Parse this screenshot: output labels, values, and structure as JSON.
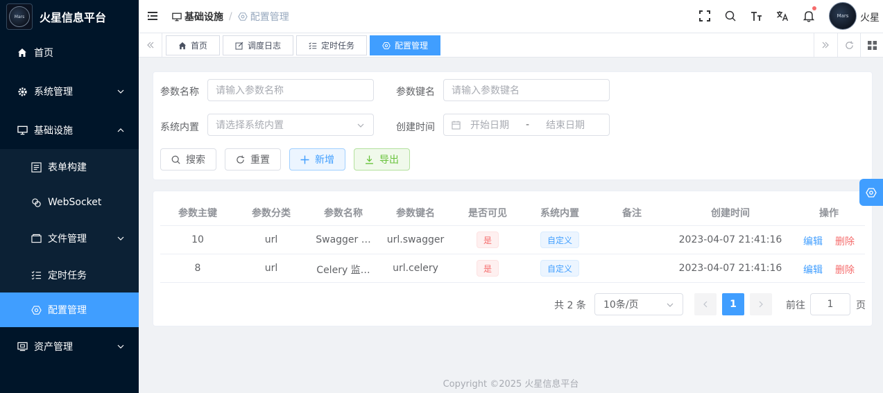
{
  "app": {
    "title": "火星信息平台",
    "logo_text": "MarsMgn",
    "user_name": "火星",
    "footer": "Copyright ©2025 火星信息平台"
  },
  "sidebar": {
    "items": [
      {
        "label": "首页",
        "icon": "home-icon"
      },
      {
        "label": "系统管理",
        "icon": "gear-icon",
        "expandable": true
      },
      {
        "label": "基础设施",
        "icon": "monitor-icon",
        "expandable": true,
        "expanded": true
      },
      {
        "label": "表单构建",
        "icon": "form-icon",
        "sub": true
      },
      {
        "label": "WebSocket",
        "icon": "link-icon",
        "sub": true
      },
      {
        "label": "文件管理",
        "icon": "folder-icon",
        "sub": true,
        "expandable": true
      },
      {
        "label": "定时任务",
        "icon": "task-list-icon",
        "sub": true
      },
      {
        "label": "配置管理",
        "icon": "config-icon",
        "sub": true,
        "active": true
      },
      {
        "label": "资产管理",
        "icon": "asset-icon",
        "expandable": true
      }
    ]
  },
  "header": {
    "breadcrumb": [
      "基础设施",
      "配置管理"
    ]
  },
  "tags": [
    {
      "label": "首页",
      "icon": "home-icon"
    },
    {
      "label": "调度日志",
      "icon": "edit-icon"
    },
    {
      "label": "定时任务",
      "icon": "task-list-icon"
    },
    {
      "label": "配置管理",
      "icon": "config-icon",
      "active": true
    }
  ],
  "search": {
    "param_name_label": "参数名称",
    "param_name_placeholder": "请输入参数名称",
    "param_key_label": "参数键名",
    "param_key_placeholder": "请输入参数键名",
    "builtin_label": "系统内置",
    "builtin_placeholder": "请选择系统内置",
    "created_label": "创建时间",
    "start_placeholder": "开始日期",
    "range_sep": "-",
    "end_placeholder": "结束日期",
    "btn_search": "搜索",
    "btn_reset": "重置",
    "btn_add": "新增",
    "btn_export": "导出"
  },
  "table": {
    "columns": [
      "参数主键",
      "参数分类",
      "参数名称",
      "参数键名",
      "是否可见",
      "系统内置",
      "备注",
      "创建时间",
      "操作"
    ],
    "rows": [
      {
        "id": "10",
        "category": "url",
        "name": "Swagger …",
        "key": "url.swagger",
        "visible": "是",
        "builtin": "自定义",
        "remark": "",
        "created": "2023-04-07 21:41:16"
      },
      {
        "id": "8",
        "category": "url",
        "name": "Celery 监…",
        "key": "url.celery",
        "visible": "是",
        "builtin": "自定义",
        "remark": "",
        "created": "2023-04-07 21:41:16"
      }
    ],
    "action_edit": "编辑",
    "action_delete": "删除"
  },
  "pagination": {
    "total": "共 2 条",
    "page_size": "10条/页",
    "current": "1",
    "goto_label": "前往",
    "goto_value": "1",
    "page_suffix": "页"
  },
  "colors": {
    "sidebar_bg": "#001529",
    "primary": "#409eff",
    "danger": "#f56c6c",
    "success": "#67c23a"
  }
}
